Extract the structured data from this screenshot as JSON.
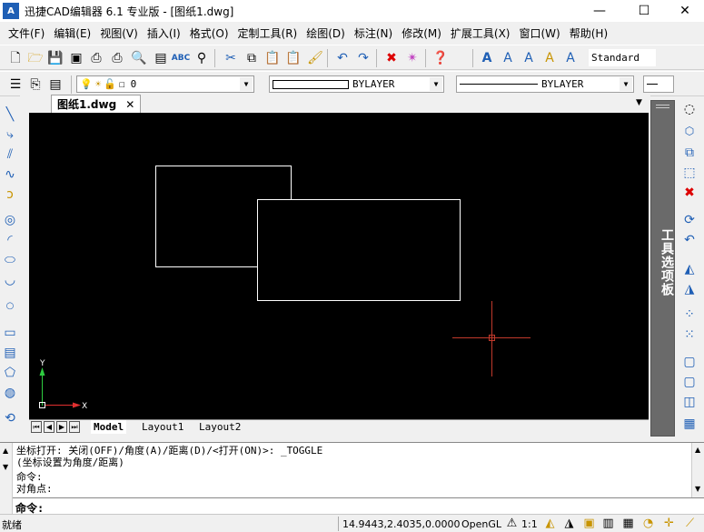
{
  "window": {
    "title": "迅捷CAD编辑器 6.1 专业版  - [图纸1.dwg]",
    "minimize_glyph": "—",
    "maximize_glyph": "☐",
    "close_glyph": "✕"
  },
  "menu": [
    "文件(F)",
    "编辑(E)",
    "视图(V)",
    "插入(I)",
    "格式(O)",
    "定制工具(R)",
    "绘图(D)",
    "标注(N)",
    "修改(M)",
    "扩展工具(X)",
    "窗口(W)",
    "帮助(H)"
  ],
  "toolbar_top": {
    "text_style": "Standard"
  },
  "toolbar_layers": {
    "layer_name": "0",
    "color": "BYLAYER",
    "linetype": "BYLAYER"
  },
  "document": {
    "tab_label": "图纸1.dwg",
    "tab_close": "✕"
  },
  "canvas": {
    "ucs_y": "Y",
    "ucs_x": "X",
    "background": "#000000",
    "line_color": "#ffffff",
    "crosshair_color": "#c0392b"
  },
  "layout_tabs": [
    "Model",
    "Layout1",
    "Layout2"
  ],
  "palette": {
    "label": "工具选项板"
  },
  "command": {
    "lines": [
      "坐标打开: 关闭(OFF)/角度(A)/距离(D)/<打开(ON)>: _TOGGLE",
      "(坐标设置为角度/距离)",
      "命令:",
      "对角点:"
    ],
    "prompt": "命令:"
  },
  "status": {
    "text": "就绪",
    "coordinates": "14.9443,2.4035,0.0000",
    "renderer": "OpenGL",
    "scale": "1:1"
  },
  "colors": {
    "accent": "#1f5fb5",
    "palette_bg": "#6a6a6a"
  }
}
